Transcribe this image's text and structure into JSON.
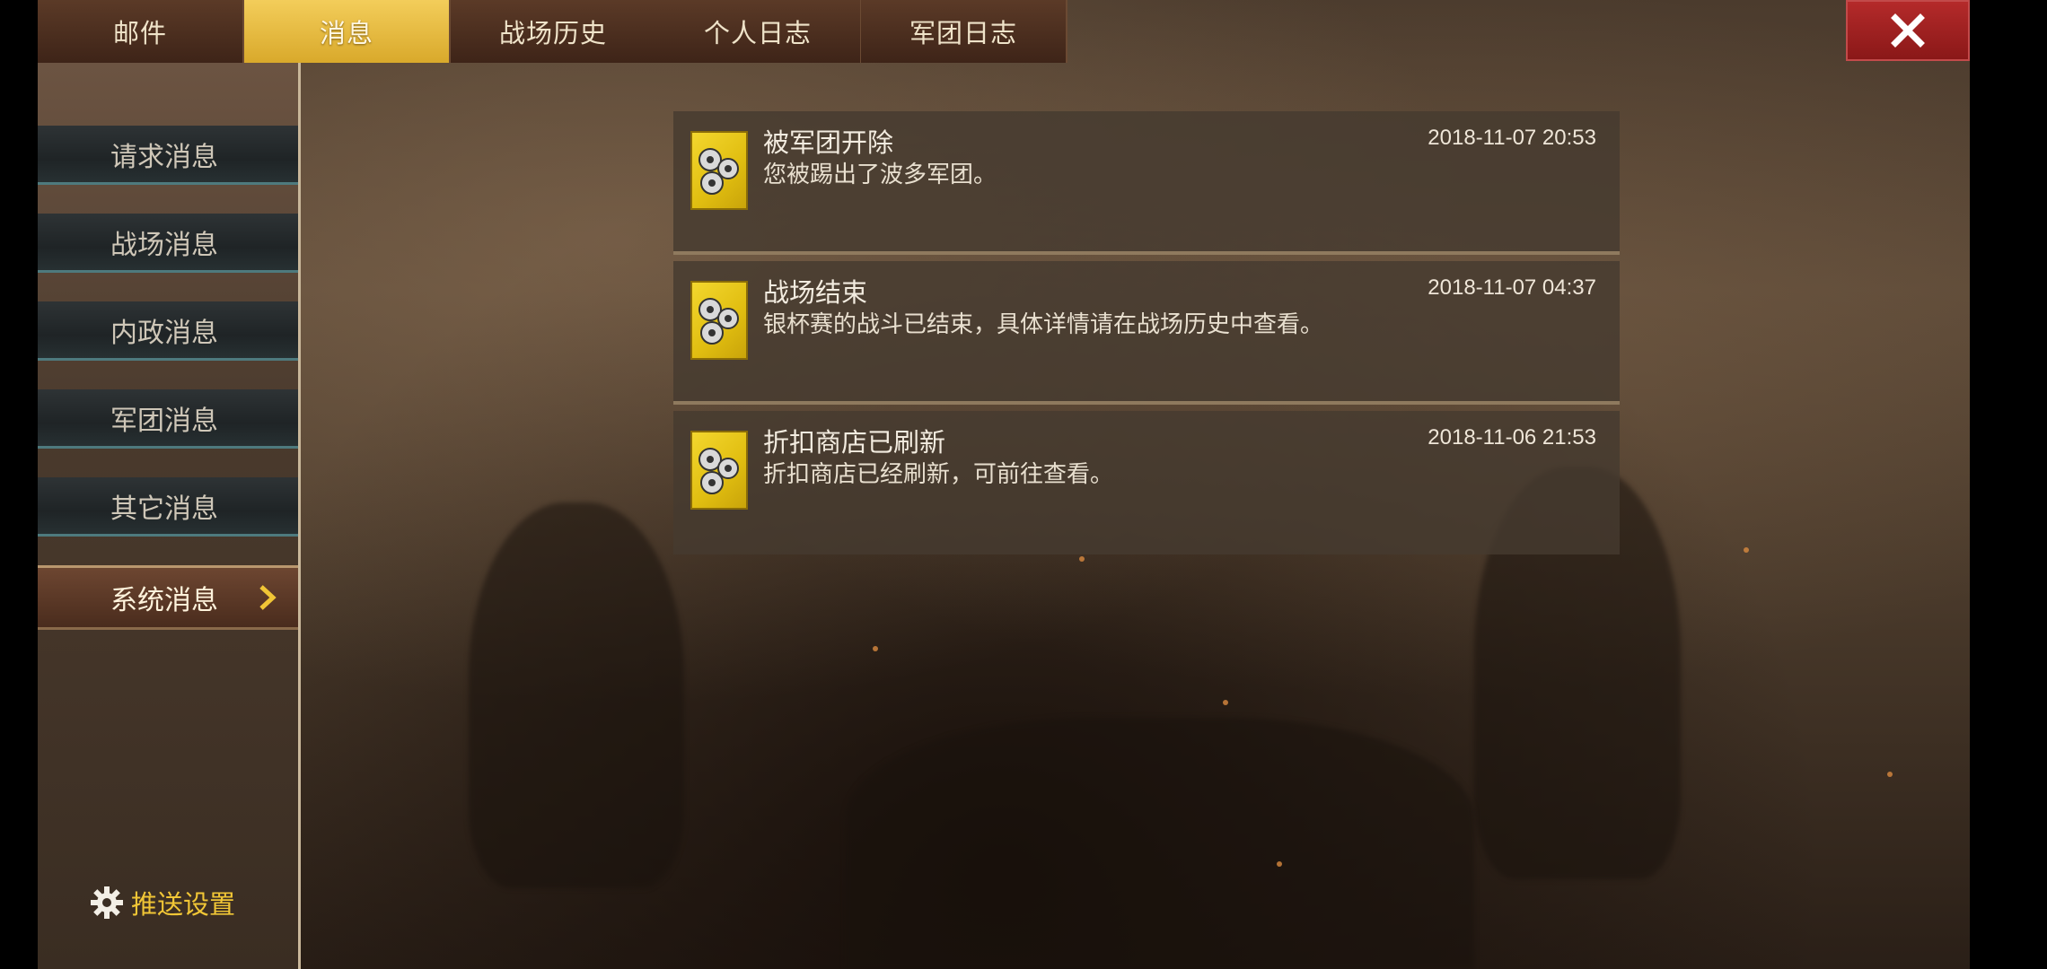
{
  "tabs": [
    {
      "label": "邮件"
    },
    {
      "label": "消息"
    },
    {
      "label": "战场历史"
    },
    {
      "label": "个人日志"
    },
    {
      "label": "军团日志"
    }
  ],
  "active_tab": "消息",
  "sidebar": {
    "items": [
      {
        "label": "请求消息"
      },
      {
        "label": "战场消息"
      },
      {
        "label": "内政消息"
      },
      {
        "label": "军团消息"
      },
      {
        "label": "其它消息"
      },
      {
        "label": "系统消息"
      }
    ],
    "active_item": "系统消息",
    "push_settings_label": "推送设置"
  },
  "messages": [
    {
      "title": "被军团开除",
      "body": "您被踢出了波多军团。",
      "time": "2018-11-07 20:53",
      "icon": "gears-icon"
    },
    {
      "title": "战场结束",
      "body": "银杯赛的战斗已结束，具体详情请在战场历史中查看。",
      "time": "2018-11-07 04:37",
      "icon": "gears-icon"
    },
    {
      "title": "折扣商店已刷新",
      "body": "折扣商店已经刷新，可前往查看。",
      "time": "2018-11-06 21:53",
      "icon": "gears-icon"
    }
  ],
  "colors": {
    "active_tab": "#e3b43a",
    "close_button": "#a42020",
    "push_settings": "#f1c636",
    "icon_bg": "#f0cf20"
  }
}
